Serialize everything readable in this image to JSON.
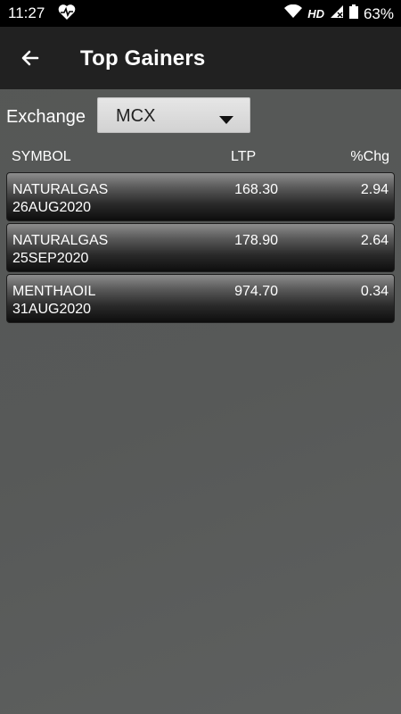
{
  "status_bar": {
    "time": "11:27",
    "network": "HD",
    "battery": "63%"
  },
  "header": {
    "title": "Top Gainers"
  },
  "filter": {
    "label": "Exchange",
    "selected": "MCX"
  },
  "table": {
    "columns": [
      "SYMBOL",
      "LTP",
      "%Chg"
    ],
    "rows": [
      {
        "symbol": "NATURALGAS",
        "expiry": "26AUG2020",
        "ltp": "168.30",
        "chg": "2.94"
      },
      {
        "symbol": "NATURALGAS",
        "expiry": "25SEP2020",
        "ltp": "178.90",
        "chg": "2.64"
      },
      {
        "symbol": "MENTHAOIL",
        "expiry": "31AUG2020",
        "ltp": "974.70",
        "chg": "0.34"
      }
    ]
  }
}
